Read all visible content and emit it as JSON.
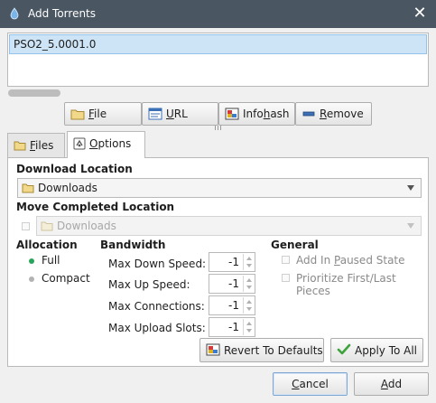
{
  "window": {
    "title": "Add Torrents",
    "close_glyph": "✕"
  },
  "torrent_list": {
    "items": [
      "PSO2_5.0001.0"
    ]
  },
  "source_buttons": {
    "file": {
      "label_prefix": "",
      "label_underline": "F",
      "label_rest": "ile",
      "icon": "folder-icon"
    },
    "url": {
      "label_prefix": "",
      "label_underline": "U",
      "label_rest": "RL",
      "icon": "url-icon"
    },
    "infohash": {
      "label_prefix": "Info",
      "label_underline": "h",
      "label_rest": "ash",
      "icon": "infohash-icon"
    },
    "remove": {
      "label_prefix": "",
      "label_underline": "R",
      "label_rest": "emove",
      "icon": "remove-icon"
    }
  },
  "tabs": [
    {
      "label_prefix": "",
      "label_underline": "F",
      "label_rest": "iles",
      "icon": "folder-icon",
      "active": false
    },
    {
      "label_prefix": "",
      "label_underline": "O",
      "label_rest": "ptions",
      "icon": "options-icon",
      "active": true
    }
  ],
  "options": {
    "download_location": {
      "title": "Download Location",
      "value": "Downloads"
    },
    "move_completed": {
      "title": "Move Completed Location",
      "value": "Downloads",
      "checked": false,
      "enabled": false
    },
    "allocation": {
      "title": "Allocation",
      "choices": [
        {
          "label": "Full",
          "selected": true
        },
        {
          "label": "Compact",
          "selected": false
        }
      ]
    },
    "bandwidth": {
      "title": "Bandwidth",
      "fields": [
        {
          "label": "Max Down Speed:",
          "value": "-1"
        },
        {
          "label": "Max Up Speed:",
          "value": "-1"
        },
        {
          "label": "Max Connections:",
          "value": "-1"
        },
        {
          "label": "Max Upload Slots:",
          "value": "-1"
        }
      ]
    },
    "general": {
      "title": "General",
      "checks": [
        {
          "label_prefix": "Add In ",
          "label_underline": "P",
          "label_rest": "aused State",
          "checked": false
        },
        {
          "label_prefix": "Prioritize First/Last Pieces",
          "label_underline": "",
          "label_rest": "",
          "checked": false
        }
      ]
    },
    "revert_button": "Revert To Defaults",
    "apply_all_button": "Apply To All"
  },
  "dialog_buttons": {
    "cancel": {
      "label_prefix": "",
      "label_underline": "C",
      "label_rest": "ancel"
    },
    "add": {
      "label_prefix": "",
      "label_underline": "A",
      "label_rest": "dd"
    }
  },
  "colors": {
    "titlebar": "#4b5663",
    "selection": "#cde4f7",
    "selection_border": "#93c3eb",
    "radio_selected": "#2aa45b",
    "folder": "#e9c86a"
  }
}
